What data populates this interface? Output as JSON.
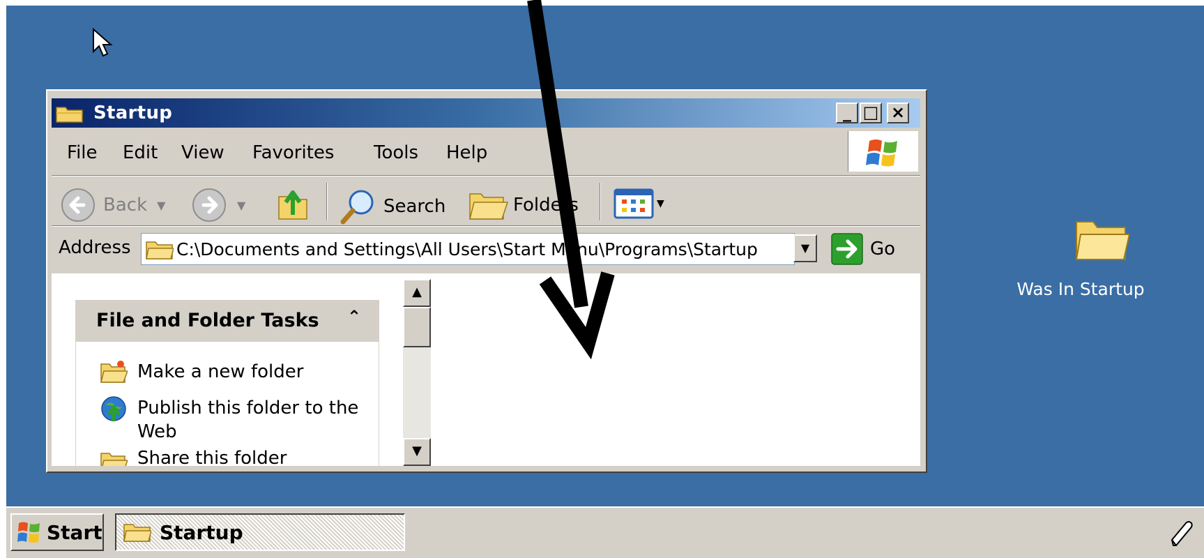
{
  "window": {
    "title": "Startup"
  },
  "menu": {
    "items": [
      "File",
      "Edit",
      "View",
      "Favorites",
      "Tools",
      "Help"
    ]
  },
  "toolbar": {
    "back_label": "Back",
    "search_label": "Search",
    "folders_label": "Folders"
  },
  "address": {
    "label": "Address",
    "value": "C:\\Documents and Settings\\All Users\\Start Menu\\Programs\\Startup",
    "go_label": "Go"
  },
  "tasks": {
    "header": "File and Folder Tasks",
    "items": [
      {
        "label": "Make a new folder",
        "icon": "new-folder-icon"
      },
      {
        "label": "Publish this folder to the Web",
        "icon": "publish-web-icon"
      },
      {
        "label": "Share this folder",
        "icon": "share-folder-icon"
      }
    ]
  },
  "desktop": {
    "icon_label": "Was In Startup",
    "background_color": "#3a6ea5"
  },
  "taskbar": {
    "start_label": "Start",
    "task_button_label": "Startup"
  }
}
